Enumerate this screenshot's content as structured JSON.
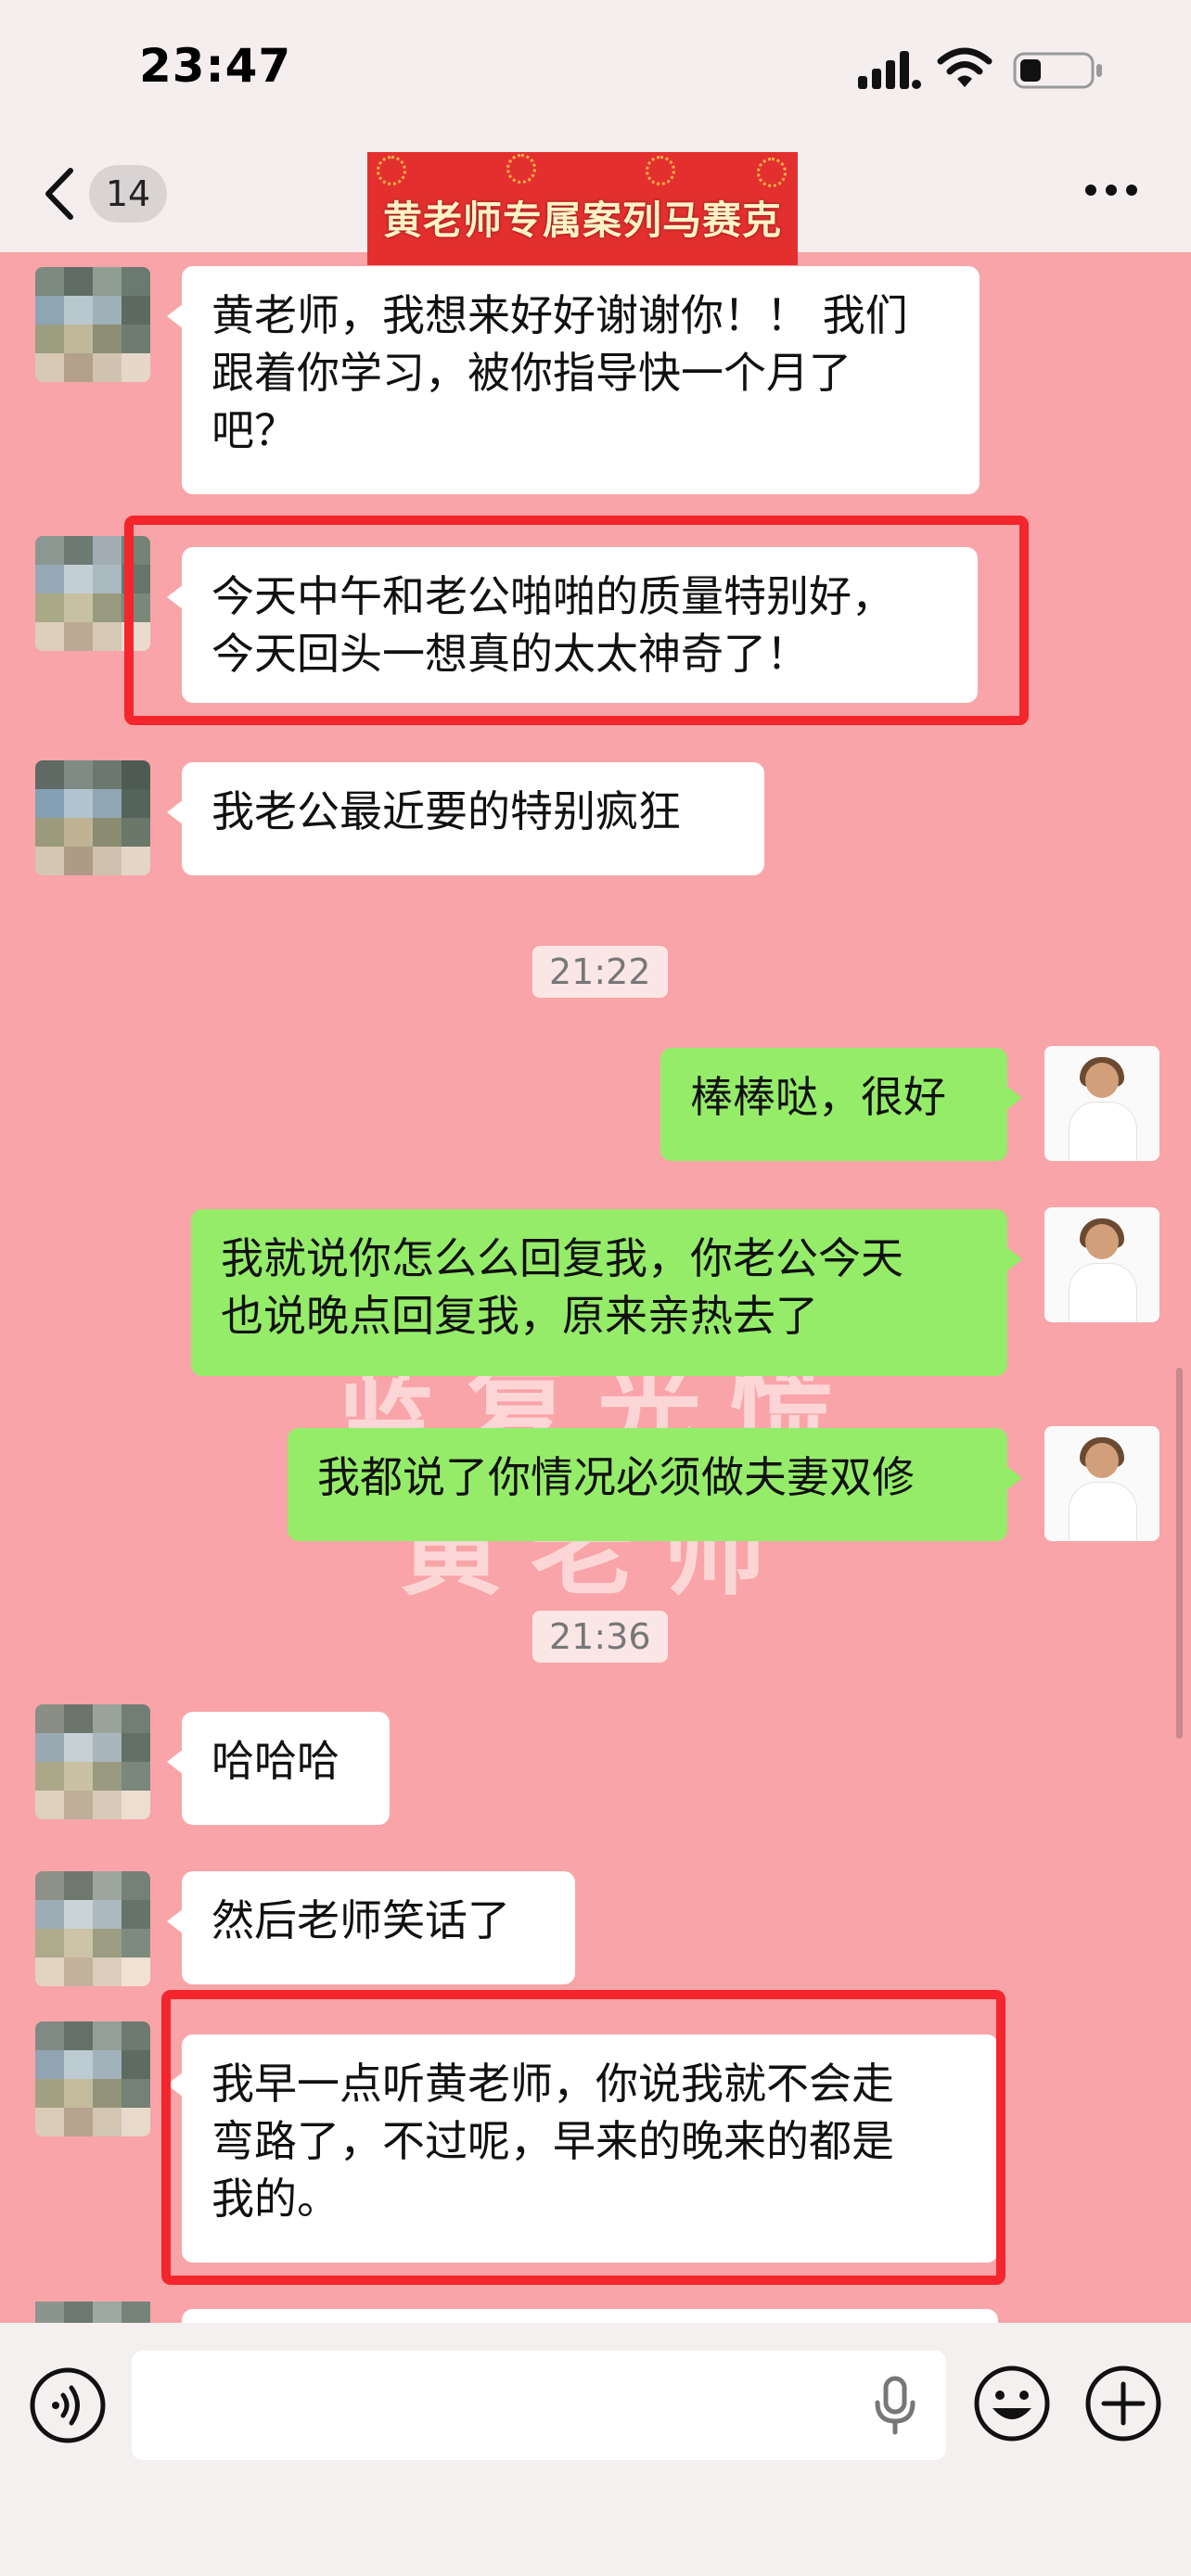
{
  "status_bar": {
    "time": "23:47"
  },
  "nav": {
    "back_count": "14",
    "title_banner": "黄老师专属案列马赛克"
  },
  "colors": {
    "chat_bg": "#f9a4a8",
    "incoming_bubble": "#ffffff",
    "outgoing_bubble": "#95ec69",
    "highlight_box": "#f4252c"
  },
  "messages": [
    {
      "side": "in",
      "text": "黄老师，我想来好好谢谢你！！ 我们\n跟着你学习，被你指导快一个月了\n吧？"
    },
    {
      "side": "in",
      "text": "今天中午和老公啪啪的质量特别好，\n今天回头一想真的太太神奇了！",
      "highlighted": true
    },
    {
      "side": "in",
      "text": "我老公最近要的特别疯狂"
    },
    {
      "type": "time",
      "text": "21:22"
    },
    {
      "side": "out",
      "text": "棒棒哒，很好"
    },
    {
      "side": "out",
      "text": "我就说你怎么么回复我，你老公今天\n也说晚点回复我，原来亲热去了"
    },
    {
      "side": "out",
      "text": "我都说了你情况必须做夫妻双修"
    },
    {
      "type": "time",
      "text": "21:36"
    },
    {
      "side": "in",
      "text": "哈哈哈"
    },
    {
      "side": "in",
      "text": "然后老师笑话了"
    },
    {
      "side": "in",
      "text": "我早一点听黄老师，你说我就不会走\n弯路了，不过呢，早来的晚来的都是\n我的。",
      "highlighted": true
    }
  ],
  "watermark": {
    "line1": "蓝复光慌",
    "line2": "黄老师"
  },
  "input_bar": {
    "placeholder": ""
  },
  "icons": [
    "back-chevron-icon",
    "more-icon",
    "voice-icon",
    "microphone-icon",
    "emoji-icon",
    "plus-icon",
    "signal-icon",
    "wifi-icon",
    "battery-icon"
  ]
}
